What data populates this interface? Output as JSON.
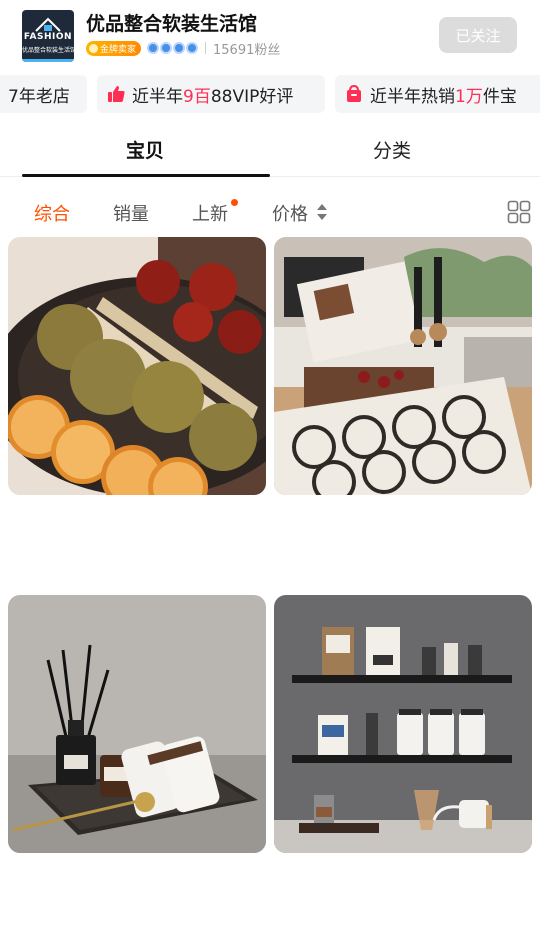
{
  "shop": {
    "logo_line1": "FASHION",
    "logo_line2": "优品整合软装生活馆",
    "name": "优品整合软装生活馆",
    "gold_badge": "金牌卖家",
    "fans": "15691粉丝",
    "follow_label": "已关注",
    "level_icons": [
      "crown-icon",
      "crown-icon",
      "crown-icon",
      "crown-icon"
    ]
  },
  "tags": {
    "tag1": {
      "text": "7年老店"
    },
    "tag2": {
      "pre": "近半年",
      "hl": "9百",
      "post": "88VIP好评",
      "icon": "thumbs-up-icon"
    },
    "tag3": {
      "pre": "近半年热销",
      "hl": "1万",
      "post": "件宝",
      "icon": "shopping-bag-icon"
    }
  },
  "tabs": [
    {
      "label": "宝贝",
      "active": true
    },
    {
      "label": "分类",
      "active": false
    }
  ],
  "sort": {
    "items": [
      {
        "label": "综合",
        "active": true
      },
      {
        "label": "销量",
        "active": false
      },
      {
        "label": "上新",
        "active": false
      },
      {
        "label": "价格",
        "active": false
      }
    ],
    "layout_toggle_icon": "grid-icon"
  },
  "products": [
    {
      "image": "dried-fruit-and-orange-slices-photo"
    },
    {
      "image": "kitchen-counter-with-book-stand-photo"
    },
    {
      "image": "reed-diffuser-tray-set-photo"
    },
    {
      "image": "wall-shelves-with-canisters-photo"
    }
  ],
  "colors": {
    "accent": "#ff5000",
    "highlight": "#ff2e54",
    "follow_bg": "#dcdcdc",
    "tag_bg": "#f4f5f7"
  }
}
